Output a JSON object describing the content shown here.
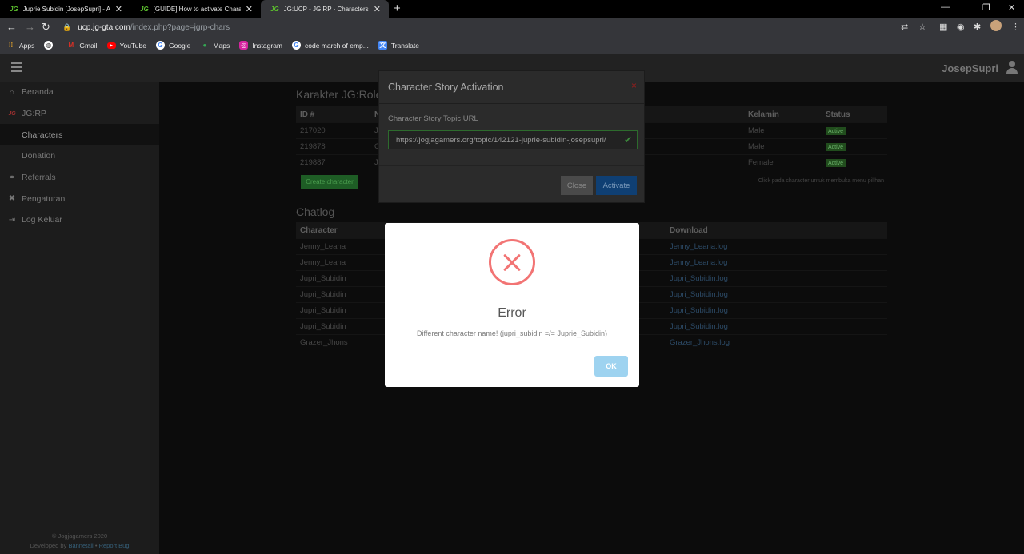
{
  "browser": {
    "tabs": [
      {
        "logo": "JG",
        "title": "Juprie Subidin [JosepSupri] - Acti",
        "active": false
      },
      {
        "logo": "JG",
        "title": "[GUIDE] How to activate Characte",
        "active": false
      },
      {
        "logo": "JG",
        "title": "JG:UCP - JG:RP - Characters",
        "active": true
      }
    ],
    "url_domain": "ucp.jg-gta.com",
    "url_path": "/index.php?page=jgrp-chars",
    "bookmarks": [
      {
        "label": "Apps",
        "icon": "apps-grid-icon",
        "color": "#e6a52a"
      },
      {
        "label": "",
        "icon": "globe-icon",
        "color": "#ffffff"
      },
      {
        "label": "Gmail",
        "icon": "gmail-icon",
        "color": "#d93025"
      },
      {
        "label": "YouTube",
        "icon": "youtube-icon",
        "color": "#ff0000"
      },
      {
        "label": "Google",
        "icon": "google-icon",
        "color": "#ffffff"
      },
      {
        "label": "Maps",
        "icon": "maps-icon",
        "color": "#34a853"
      },
      {
        "label": "Instagram",
        "icon": "instagram-icon",
        "color": "#d6249f"
      },
      {
        "label": "code march of emp...",
        "icon": "google-icon",
        "color": "#ffffff"
      },
      {
        "label": "Translate",
        "icon": "translate-icon",
        "color": "#4285f4"
      }
    ]
  },
  "app": {
    "username": "JosepSupri",
    "sidebar": {
      "items": [
        {
          "label": "Beranda",
          "icon": "home-icon",
          "sub": false,
          "selected": false
        },
        {
          "label": "JG:RP",
          "icon": "jg-logo-icon",
          "sub": false,
          "selected": false
        },
        {
          "label": "Characters",
          "icon": "",
          "sub": true,
          "selected": true
        },
        {
          "label": "Donation",
          "icon": "",
          "sub": true,
          "selected": false
        },
        {
          "label": "Referrals",
          "icon": "handshake-icon",
          "sub": false,
          "selected": false
        },
        {
          "label": "Pengaturan",
          "icon": "wrench-icon",
          "sub": false,
          "selected": false
        },
        {
          "label": "Log Keluar",
          "icon": "logout-icon",
          "sub": false,
          "selected": false
        }
      ],
      "footer_line1": "© Jogjagamers 2020",
      "footer_prefix": "Developed by",
      "footer_author": "Bannetall",
      "footer_sep": "•",
      "footer_report": "Report Bug"
    },
    "characters": {
      "title": "Karakter JG:Role",
      "headers": [
        "ID #",
        "N",
        "Kelamin",
        "Status"
      ],
      "rows": [
        {
          "id": "217020",
          "n": "J",
          "gender": "Male",
          "status": "Active"
        },
        {
          "id": "219878",
          "n": "G",
          "gender": "Male",
          "status": "Active"
        },
        {
          "id": "219887",
          "n": "J",
          "gender": "Female",
          "status": "Active"
        }
      ],
      "create_button": "Create character",
      "hint": "Click pada character untuk membuka menu pilihan"
    },
    "chatlog": {
      "title": "Chatlog",
      "headers": [
        "Character",
        "Download"
      ],
      "rows": [
        {
          "character": "Jenny_Leana",
          "download": "Jenny_Leana.log"
        },
        {
          "character": "Jenny_Leana",
          "download": "Jenny_Leana.log"
        },
        {
          "character": "Jupri_Subidin",
          "download": "Jupri_Subidin.log"
        },
        {
          "character": "Jupri_Subidin",
          "download": "Jupri_Subidin.log"
        },
        {
          "character": "Jupri_Subidin",
          "download": "Jupri_Subidin.log"
        },
        {
          "character": "Jupri_Subidin",
          "download": "Jupri_Subidin.log"
        },
        {
          "character": "Grazer_Jhons",
          "download": "Grazer_Jhons.log"
        }
      ]
    }
  },
  "modal": {
    "title": "Character Story Activation",
    "close_glyph": "×",
    "field_label": "Character Story Topic URL",
    "field_value": "https://jogjagamers.org/topic/142121-juprie-subidin-josepsupri/",
    "close_button": "Close",
    "activate_button": "Activate"
  },
  "error_dialog": {
    "title": "Error",
    "message": "Different character name! (jupri_subidin =/= Juprie_Subidin)",
    "ok_button": "OK"
  }
}
